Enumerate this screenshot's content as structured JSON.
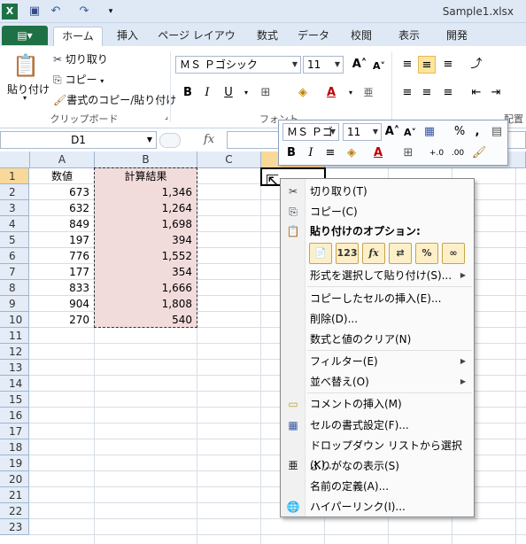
{
  "title": "Sample1.xlsx",
  "tabs": {
    "file": "",
    "home": "ホーム",
    "insert": "挿入",
    "layout": "ページ レイアウト",
    "formulas": "数式",
    "data": "データ",
    "review": "校閲",
    "view": "表示",
    "developer": "開発"
  },
  "ribbon": {
    "paste": "貼り付け",
    "cut": "切り取り",
    "copy": "コピー",
    "format_painter": "書式のコピー/貼り付け",
    "clipboard_group": "クリップボード",
    "font_name": "ＭＳ Ｐゴシック",
    "font_size": "11",
    "font_group": "フォント",
    "placement_group": "配置"
  },
  "namebox": "D1",
  "fx": "fx",
  "columns": [
    "A",
    "B",
    "C"
  ],
  "rows": [
    "1",
    "2",
    "3",
    "4",
    "5",
    "6",
    "7",
    "8",
    "9",
    "10",
    "11",
    "12",
    "13",
    "14",
    "15",
    "16",
    "17",
    "18",
    "19",
    "20",
    "21",
    "22",
    "23"
  ],
  "header_a": "数値",
  "header_b": "計算結果",
  "values_a": [
    "673",
    "632",
    "849",
    "197",
    "776",
    "177",
    "833",
    "904",
    "270"
  ],
  "values_b": [
    "1,346",
    "1,264",
    "1,698",
    "394",
    "1,552",
    "354",
    "1,666",
    "1,808",
    "540"
  ],
  "mini": {
    "font_name": "ＭＳ Ｐゴ",
    "font_size": "11"
  },
  "menu": {
    "cut": "切り取り(T)",
    "copy": "コピー(C)",
    "paste_options": "貼り付けのオプション:",
    "paste_special": "形式を選択して貼り付け(S)...",
    "insert_copied": "コピーしたセルの挿入(E)...",
    "delete": "削除(D)...",
    "clear": "数式と値のクリア(N)",
    "filter": "フィルター(E)",
    "sort": "並べ替え(O)",
    "insert_comment": "コメントの挿入(M)",
    "format_cells": "セルの書式設定(F)...",
    "pick_list": "ドロップダウン リストから選択(K)...",
    "phonetic": "ふりがなの表示(S)",
    "define_name": "名前の定義(A)...",
    "hyperlink": "ハイパーリンク(I)..."
  },
  "paste_icons": [
    "paste",
    "123",
    "fx",
    "transpose",
    "%",
    "link"
  ]
}
